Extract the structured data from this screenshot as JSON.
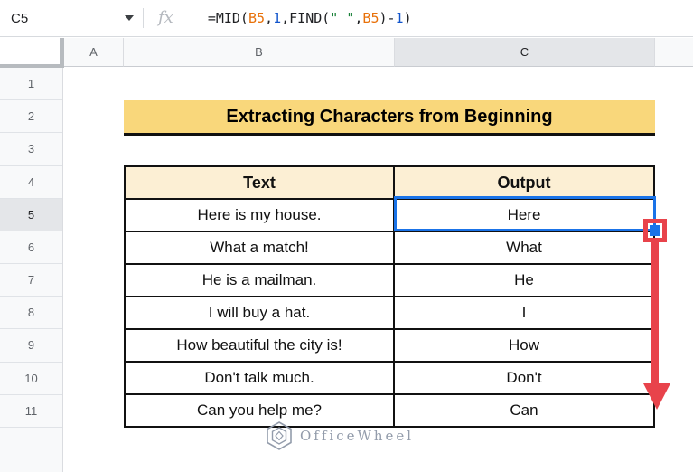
{
  "formula_bar": {
    "name_box_value": "C5",
    "fx_label": "fx",
    "formula_full": "=MID(B5,1,FIND(\" \",B5)-1)",
    "formula_segments": [
      {
        "text": "=MID(",
        "type": "plain",
        "color": "#202124"
      },
      {
        "text": "B5",
        "type": "ref",
        "color": "#E8710A"
      },
      {
        "text": ",",
        "type": "plain",
        "color": "#202124"
      },
      {
        "text": "1",
        "type": "num",
        "color": "#1155CC"
      },
      {
        "text": ",FIND(",
        "type": "plain",
        "color": "#202124"
      },
      {
        "text": "\" \"",
        "type": "str",
        "color": "#188038"
      },
      {
        "text": ",",
        "type": "plain",
        "color": "#202124"
      },
      {
        "text": "B5",
        "type": "ref",
        "color": "#E8710A"
      },
      {
        "text": ")-",
        "type": "plain",
        "color": "#202124"
      },
      {
        "text": "1",
        "type": "num",
        "color": "#1155CC"
      },
      {
        "text": ")",
        "type": "plain",
        "color": "#202124"
      }
    ]
  },
  "grid": {
    "column_headers": [
      "A",
      "B",
      "C"
    ],
    "selected_column_header": "C",
    "row_headers": [
      "1",
      "2",
      "3",
      "4",
      "5",
      "6",
      "7",
      "8",
      "9",
      "10",
      "11"
    ],
    "selected_row_header": "5",
    "selected_cell": "C5"
  },
  "content": {
    "title_banner": {
      "text": "Extracting Characters from Beginning"
    },
    "table": {
      "columns": [
        "Text",
        "Output"
      ],
      "rows": [
        {
          "text": "Here is my house.",
          "output": "Here"
        },
        {
          "text": "What a match!",
          "output": "What"
        },
        {
          "text": "He is a mailman.",
          "output": "He"
        },
        {
          "text": "I will buy a hat.",
          "output": "I"
        },
        {
          "text": "How beautiful the city is!",
          "output": "How"
        },
        {
          "text": "Don't talk much.",
          "output": "Don't"
        },
        {
          "text": "Can you help me?",
          "output": "Can"
        }
      ]
    }
  },
  "annotations": {
    "fill_handle_drag": {
      "type": "drag-down-arrow",
      "from_cell": "C5",
      "to_row": "11",
      "color": "#E8434B"
    }
  },
  "watermark": {
    "text": "OfficeWheel"
  },
  "colors": {
    "selection_blue": "#1A73E8",
    "annotation_red": "#E8434B",
    "title_fill": "#F9D77B",
    "table_header_fill": "#FCEFD4",
    "header_bg": "#F8F9FA",
    "header_selected_bg": "#E4E6E9",
    "formula_ref_orange": "#E8710A",
    "formula_num_blue": "#1155CC",
    "formula_str_green": "#188038"
  }
}
